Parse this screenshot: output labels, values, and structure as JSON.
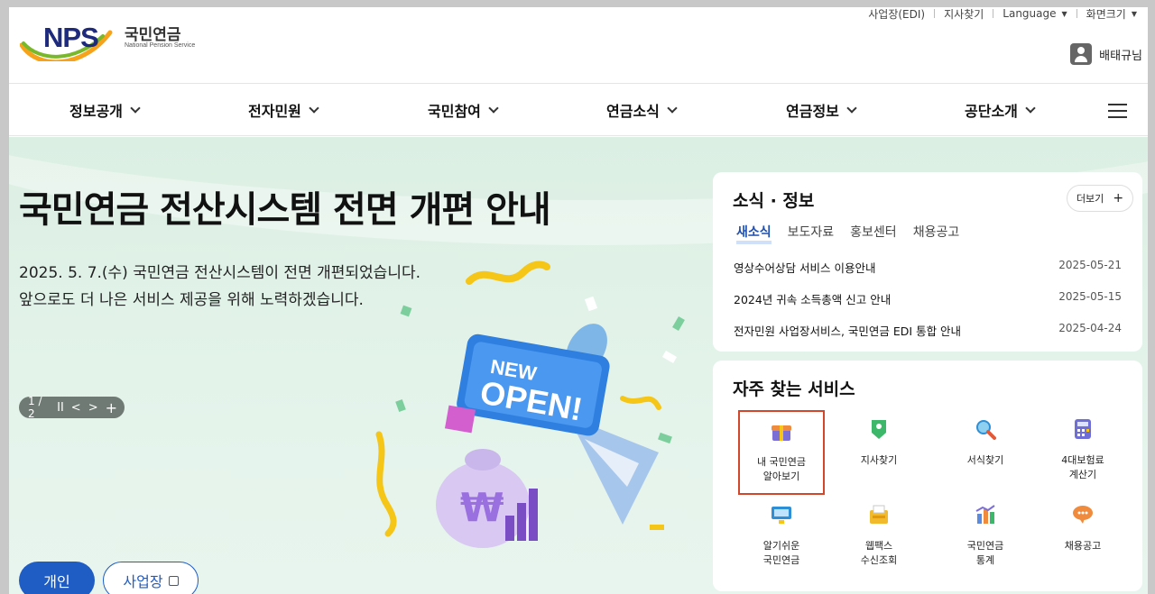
{
  "header": {
    "logo_text": "NPS",
    "logo_kor": "국민연금",
    "logo_eng": "National Pension Service",
    "util": [
      {
        "label": "사업장(EDI)",
        "dropdown": false
      },
      {
        "label": "지사찾기",
        "dropdown": false
      },
      {
        "label": "Language",
        "dropdown": true
      },
      {
        "label": "화면크기",
        "dropdown": true
      }
    ],
    "user_name": "배태규님"
  },
  "gnb": {
    "items": [
      "정보공개",
      "전자민원",
      "국민참여",
      "연금소식",
      "연금정보",
      "공단소개"
    ],
    "menu_icon": "hamburger-icon"
  },
  "hero": {
    "title": "국민연금 전산시스템 전면 개편 안내",
    "line1": "2025. 5. 7.(수) 국민연금 전산시스템이 전면 개편되었습니다.",
    "line2": "앞으로도 더 나은 서비스 제공을 위해 노력하겠습니다.",
    "pager": {
      "current": "1",
      "sep": "/",
      "total": "2",
      "pause": "II",
      "prev": "<",
      "next": ">",
      "add": "+"
    },
    "ticket_line1": "NEW",
    "ticket_line2": "OPEN!",
    "bag_symbol": "₩",
    "btn_individual": "개인",
    "btn_business": "사업장"
  },
  "news": {
    "title": "소식 · 정보",
    "more": "더보기",
    "tabs": [
      "새소식",
      "보도자료",
      "홍보센터",
      "채용공고"
    ],
    "active_tab": 0,
    "rows": [
      {
        "title": "영상수어상담 서비스 이용안내",
        "date": "2025-05-21"
      },
      {
        "title": "2024년 귀속 소득총액 신고 안내",
        "date": "2025-05-15"
      },
      {
        "title": "전자민원 사업장서비스, 국민연금 EDI 통합 안내",
        "date": "2025-04-24"
      }
    ]
  },
  "services": {
    "title": "자주 찾는 서비스",
    "items": [
      {
        "line1": "내 국민연금",
        "line2": "알아보기",
        "icon": "gift-icon",
        "color": "#7b6fd6"
      },
      {
        "line1": "지사찾기",
        "line2": "",
        "icon": "map-pin-icon",
        "color": "#3db86a"
      },
      {
        "line1": "서식찾기",
        "line2": "",
        "icon": "magnifier-icon",
        "color": "#e05b3a"
      },
      {
        "line1": "4대보험료",
        "line2": "계산기",
        "icon": "calculator-icon",
        "color": "#6e6ed6"
      },
      {
        "line1": "알기쉬운",
        "line2": "국민연금",
        "icon": "monitor-icon",
        "color": "#2f8fd6"
      },
      {
        "line1": "웹팩스",
        "line2": "수신조회",
        "icon": "fax-icon",
        "color": "#f1b92c"
      },
      {
        "line1": "국민연금",
        "line2": "통계",
        "icon": "bar-chart-icon",
        "color": "#5a8be0"
      },
      {
        "line1": "채용공고",
        "line2": "",
        "icon": "speech-bubble-icon",
        "color": "#f08a3c"
      }
    ]
  },
  "colors": {
    "brand_blue": "#1f5cc4",
    "logo_navy": "#1d2a7d",
    "highlight": "#d2472c",
    "hero_bg": "#dcefe3"
  }
}
